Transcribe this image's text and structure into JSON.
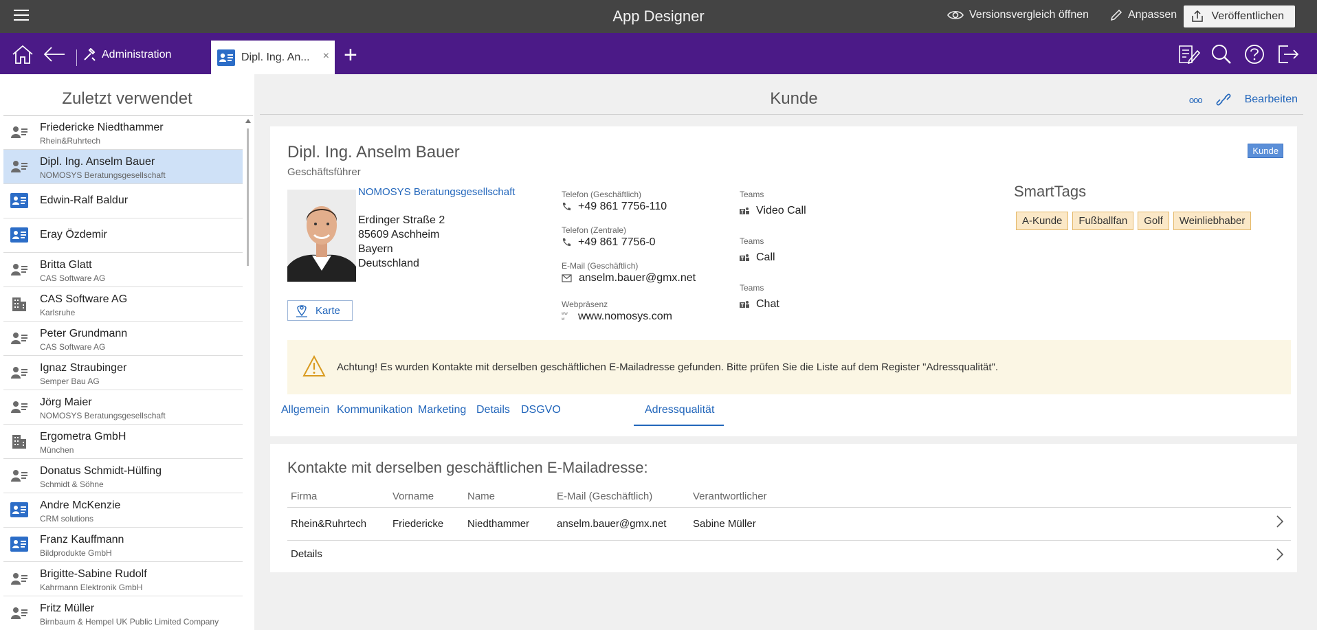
{
  "topbar": {
    "app_title": "App Designer",
    "compare_label": "Versionsvergleich öffnen",
    "customize_label": "Anpassen",
    "publish_label": "Veröffentlichen"
  },
  "navbar": {
    "admin_label": "Administration",
    "active_tab_label": "Dipl. Ing. An...",
    "close_glyph": "×",
    "plus_glyph": "+"
  },
  "sidebar": {
    "title": "Zuletzt verwendet",
    "items": [
      {
        "name": "Friedericke Niedthammer",
        "sub": "Rhein&Ruhrtech",
        "icon": "person-icon"
      },
      {
        "name": "Dipl. Ing. Anselm Bauer",
        "sub": "NOMOSYS Beratungsgesellschaft",
        "icon": "person-icon",
        "selected": true
      },
      {
        "name": "Edwin-Ralf Baldur",
        "sub": "",
        "icon": "contact-card-icon"
      },
      {
        "name": "Eray Özdemir",
        "sub": "",
        "icon": "contact-card-icon"
      },
      {
        "name": "Britta Glatt",
        "sub": "CAS Software AG",
        "icon": "person-icon"
      },
      {
        "name": "CAS Software AG",
        "sub": "Karlsruhe",
        "icon": "building-icon"
      },
      {
        "name": "Peter Grundmann",
        "sub": "CAS Software AG",
        "icon": "person-icon"
      },
      {
        "name": "Ignaz Straubinger",
        "sub": "Semper Bau AG",
        "icon": "person-icon"
      },
      {
        "name": "Jörg Maier",
        "sub": "NOMOSYS Beratungsgesellschaft",
        "icon": "person-icon"
      },
      {
        "name": "Ergometra GmbH",
        "sub": "München",
        "icon": "building-icon"
      },
      {
        "name": "Donatus Schmidt-Hülfing",
        "sub": "Schmidt & Söhne",
        "icon": "person-icon"
      },
      {
        "name": "Andre McKenzie",
        "sub": "CRM solutions",
        "icon": "contact-card-icon"
      },
      {
        "name": "Franz Kauffmann",
        "sub": "Bildprodukte GmbH",
        "icon": "contact-card-icon"
      },
      {
        "name": "Brigitte-Sabine Rudolf",
        "sub": "Kahrmann Elektronik GmbH",
        "icon": "person-icon"
      },
      {
        "name": "Fritz Müller",
        "sub": "Birnbaum & Hempel UK Public Limited Company",
        "icon": "person-icon"
      }
    ]
  },
  "page": {
    "title": "Kunde",
    "more_glyph": "ooo",
    "edit_label": "Bearbeiten"
  },
  "contact": {
    "name": "Dipl. Ing. Anselm Bauer",
    "role": "Geschäftsführer",
    "badge": "Kunde",
    "company": "NOMOSYS Beratungsgesellschaft",
    "street": "Erdinger Straße 2",
    "city": "85609 Aschheim",
    "state": "Bayern",
    "country": "Deutschland",
    "map_label": "Karte",
    "phone_business_label": "Telefon (Geschäftlich)",
    "phone_business": "+49 861 7756-110",
    "phone_central_label": "Telefon (Zentrale)",
    "phone_central": "+49 861 7756-0",
    "email_label": "E-Mail (Geschäftlich)",
    "email": "anselm.bauer@gmx.net",
    "web_label": "Webpräsenz",
    "web": "www.nomosys.com",
    "teams": [
      {
        "label": "Teams",
        "value": "Video Call"
      },
      {
        "label": "Teams",
        "value": "Call"
      },
      {
        "label": "Teams",
        "value": "Chat"
      }
    ],
    "smarttags_title": "SmartTags",
    "smarttags": [
      "A-Kunde",
      "Fußballfan",
      "Golf",
      "Weinliebhaber"
    ],
    "warning": "Achtung! Es wurden Kontakte mit derselben geschäftlichen E-Mailadresse gefunden. Bitte prüfen Sie die Liste auf dem Register \"Adressqualität\".",
    "tabs": [
      "Allgemein",
      "Kommunikation",
      "Marketing",
      "Details",
      "DSGVO",
      "Adressqualität"
    ],
    "active_tab": "Adressqualität"
  },
  "duplicates": {
    "title": "Kontakte mit derselben geschäftlichen E-Mailadresse:",
    "columns": [
      "Firma",
      "Vorname",
      "Name",
      "E-Mail (Geschäftlich)",
      "Verantwortlicher"
    ],
    "rows": [
      [
        "Rhein&Ruhrtech",
        "Friedericke",
        "Niedthammer",
        "anselm.bauer@gmx.net",
        "Sabine Müller"
      ]
    ],
    "details_label": "Details"
  },
  "colors": {
    "topbar_bg": "#444444",
    "navbar_bg": "#4b1a87",
    "link": "#2266bb",
    "selected_row": "#cfe1f7",
    "tag_bg": "#fbe8c7",
    "warning_bg": "#fbf6e4",
    "badge_bg": "#5b8fd8"
  }
}
